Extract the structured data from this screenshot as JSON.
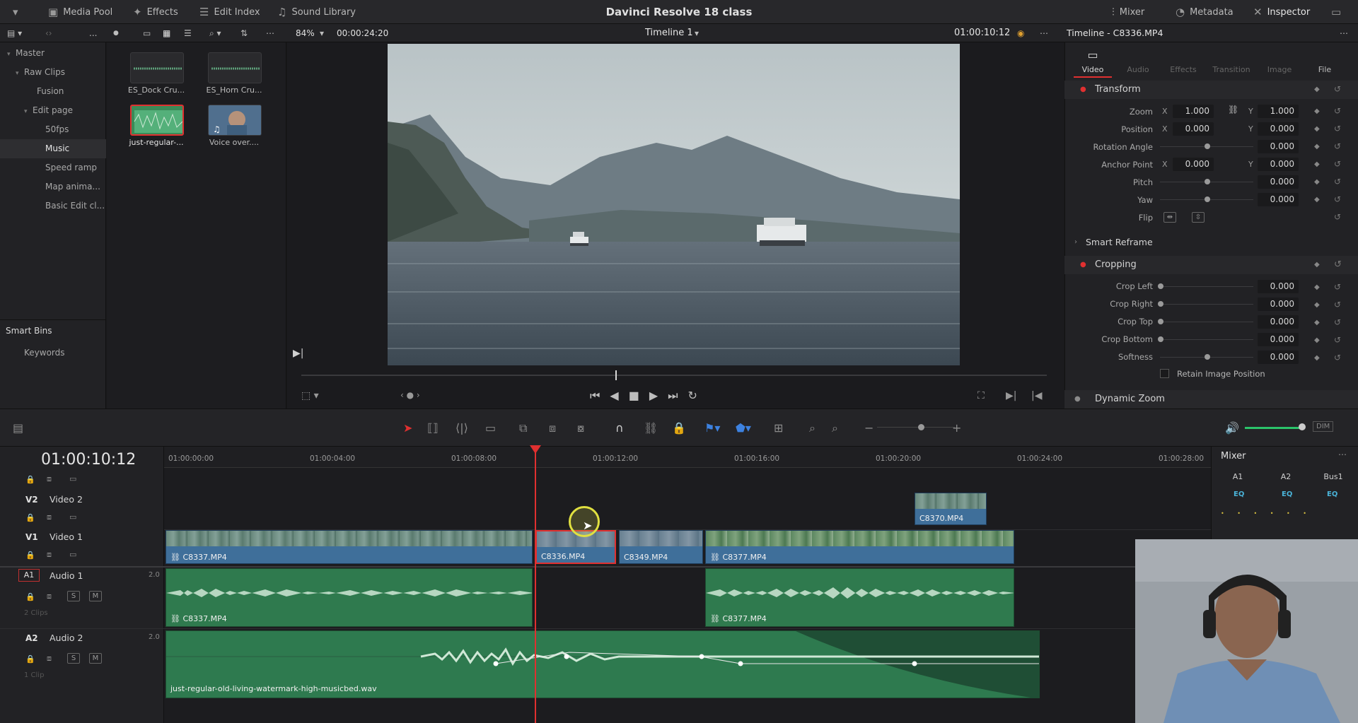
{
  "app": {
    "title": "Davinci Resolve 18 class",
    "left_tabs": [
      "Media Pool",
      "Effects",
      "Edit Index",
      "Sound Library"
    ],
    "right_tabs": [
      "Mixer",
      "Metadata",
      "Inspector"
    ],
    "ellipsis": "..."
  },
  "viewer": {
    "zoom": "84%",
    "timecode_left": "00:00:24:20",
    "timeline_name": "Timeline 1",
    "timecode_right": "01:00:10:12"
  },
  "sidebar": {
    "items": [
      "Master",
      "Raw Clips",
      "Fusion",
      "Edit page",
      "50fps",
      "Music",
      "Speed ramp",
      "Map anima...",
      "Basic Edit cl..."
    ],
    "smart_bins": "Smart Bins",
    "keywords": "Keywords"
  },
  "media": {
    "clips": [
      "ES_Dock Cru...",
      "ES_Horn Cru...",
      "just-regular-...",
      "Voice over...."
    ]
  },
  "inspector": {
    "title": "Timeline - C8336.MP4",
    "tabs": [
      "Video",
      "Audio",
      "Effects",
      "Transition",
      "Image",
      "File"
    ],
    "transform": "Transform",
    "zoom_label": "Zoom",
    "zoom_x": "1.000",
    "zoom_y": "1.000",
    "position_label": "Position",
    "pos_x": "0.000",
    "pos_y": "0.000",
    "rotation_label": "Rotation Angle",
    "rotation": "0.000",
    "anchor_label": "Anchor Point",
    "anchor_x": "0.000",
    "anchor_y": "0.000",
    "pitch_label": "Pitch",
    "pitch": "0.000",
    "yaw_label": "Yaw",
    "yaw": "0.000",
    "flip_label": "Flip",
    "smart_reframe": "Smart Reframe",
    "cropping": "Cropping",
    "crop_left_label": "Crop Left",
    "crop_left": "0.000",
    "crop_right_label": "Crop Right",
    "crop_right": "0.000",
    "crop_top_label": "Crop Top",
    "crop_top": "0.000",
    "crop_bottom_label": "Crop Bottom",
    "crop_bottom": "0.000",
    "softness_label": "Softness",
    "softness": "0.000",
    "retain": "Retain Image Position",
    "dynamic_zoom": "Dynamic Zoom",
    "x": "X",
    "y": "Y"
  },
  "timeline": {
    "timecode": "01:00:10:12",
    "ruler": [
      "01:00:00:00",
      "01:00:04:00",
      "01:00:08:00",
      "01:00:12:00",
      "01:00:16:00",
      "01:00:20:00",
      "01:00:24:00",
      "01:00:28:00"
    ],
    "tracks": {
      "v2": {
        "id": "V2",
        "name": "Video 2"
      },
      "v1": {
        "id": "V1",
        "name": "Video 1"
      },
      "a1": {
        "id": "A1",
        "name": "Audio 1",
        "ch": "2.0",
        "clips": "2 Clips"
      },
      "a2": {
        "id": "A2",
        "name": "Audio 2",
        "ch": "2.0",
        "clips": "1 Clip"
      }
    },
    "s": "S",
    "m": "M",
    "video_clips": [
      "C8337.MP4",
      "C8336.MP4",
      "C8349.MP4",
      "C8377.MP4",
      "C8370.MP4"
    ],
    "audio_clips": [
      "C8337.MP4",
      "C8377.MP4",
      "just-regular-old-living-watermark-high-musicbed.wav"
    ]
  },
  "mixer": {
    "title": "Mixer",
    "channels": [
      "A1",
      "A2",
      "Bus1"
    ],
    "eq": "EQ"
  },
  "toolbar": {
    "dim": "DIM"
  }
}
